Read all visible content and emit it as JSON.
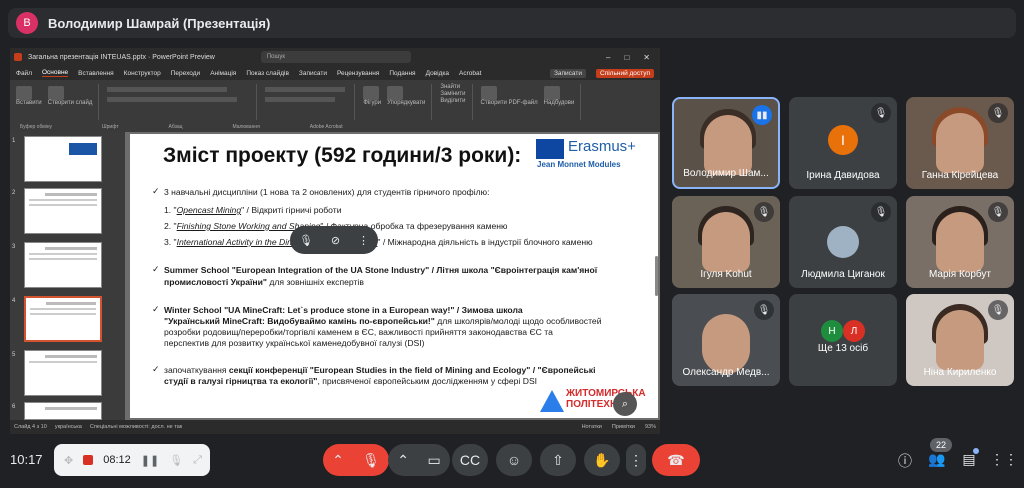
{
  "header": {
    "avatar_letter": "В",
    "title": "Володимир Шамрай (Презентація)"
  },
  "ppt": {
    "window_title": "Загальна презентація INTEUAS.pptx · PowerPoint Preview",
    "search_placeholder": "Пошук",
    "menu": [
      "Файл",
      "Основне",
      "Вставлення",
      "Конструктор",
      "Переходи",
      "Анімація",
      "Показ слайдів",
      "Записати",
      "Рецензування",
      "Подання",
      "Довідка",
      "Acrobat"
    ],
    "active_menu": "Основне",
    "record_btn": "Записати",
    "share_btn": "Спільний доступ",
    "ribbon_groups": [
      "Буфер обміну",
      "Слайди",
      "Шрифт",
      "Абзац",
      "Малювання",
      "Редагування",
      "Adobe Acrobat",
      "Надбудови"
    ],
    "ribbon_buttons": {
      "paste": "Вставити",
      "new_slide": "Створити слайд",
      "shapes": "Фігури",
      "arrange": "Упорядкувати",
      "find": "Знайти",
      "replace": "Замінити",
      "select": "Виділити",
      "create_pdf": "Створити PDF-файл",
      "addins": "Надбудови"
    },
    "thumb_numbers": [
      "1",
      "2",
      "3",
      "4",
      "5",
      "6"
    ],
    "status_left": [
      "Слайд 4 з 10",
      "українська",
      "Спеціальні можливості: досл. не так"
    ],
    "status_right": [
      "Нотатки",
      "Примітки",
      "93%"
    ]
  },
  "slide": {
    "title": "Зміст проекту (592 години/3 роки):",
    "eu_logo_text": "Erasmus+",
    "eu_logo_sub": "Jean Monnet Modules",
    "line1": "3 навчальні дисципліни (1 нова та 2 оновлених) для студентів гірничого профілю:",
    "line2a": "1. \"",
    "line2i": "Opencast Mining",
    "line2b": "\" / Відкриті гірничі роботи",
    "line3a": "2. \"",
    "line3i": "Finishing Stone Working and Shaping",
    "line3b": "\" / Фактурна обробка та фрезерування каменю",
    "line4a": "3. \"",
    "line4i": "International Activity in the Dimension Stone Industry",
    "line4b": "\" / Міжнародна діяльність в індустрії блочного каменю",
    "summer1": "Summer School \"European Integration of the UA Stone Industry\" / Літня школа \"Євроінтеграція кам'яної",
    "summer2": "промисловості України\"",
    "summer3": " для зовнішніх експертів",
    "winter1": "Winter School \"UA MineCraft: Let`s produce stone in a European way!\" / Зимова школа",
    "winter2": "\"Український MineCraft: Видобуваймо камінь по-європейськи!\"",
    "winter3": " для школярів/молоді щодо особливостей",
    "winter4": "розробки родовищ/переробки/торгівлі каменем в ЄС, важливості прийняття законодавства ЄС та",
    "winter5": "перспектив для розвитку української каменедобувної галузі (DSI)",
    "conf1a": "започаткування ",
    "conf1b": "секції конференції \"European Studies in the field of Mining and Ecology\" / \"Європейські",
    "conf2a": "студії в галузі гірництва та екології\"",
    "conf2b": ", присвяченої європейським дослідженням у сфері DSI",
    "polit1": "ЖИТОМИРСЬКА",
    "polit2": "ПОЛІТЕХНІКА"
  },
  "participants": [
    {
      "name": "Володимир Шам...",
      "speaking": true
    },
    {
      "name": "Ірина Давидова",
      "avatar": "І"
    },
    {
      "name": "Ганна Кірейцева"
    },
    {
      "name": "Ігуля Kohut"
    },
    {
      "name": "Людмила Циганок"
    },
    {
      "name": "Марія Корбут"
    },
    {
      "name": "Олександр Медв..."
    },
    {
      "name": "Ще 13 осіб",
      "avatars": [
        "Н",
        "Л"
      ]
    },
    {
      "name": "Ніна Кириленко"
    }
  ],
  "bottom": {
    "clock": "10:17",
    "rec_time": "08:12",
    "people_count": "22"
  },
  "icons": {
    "mic_off": "mic-off-icon",
    "camera": "camera-icon",
    "captions": "captions-icon",
    "emoji": "emoji-icon",
    "present": "present-icon",
    "hand": "raise-hand-icon",
    "more": "more-icon",
    "hangup": "hangup-icon",
    "info": "info-icon",
    "people": "people-icon",
    "chat": "chat-icon",
    "activities": "activities-icon"
  },
  "colors": {
    "bg": "#202124",
    "hangup": "#ea4335",
    "accent": "#8ab4f8",
    "ppt_accent": "#c43e1c"
  }
}
